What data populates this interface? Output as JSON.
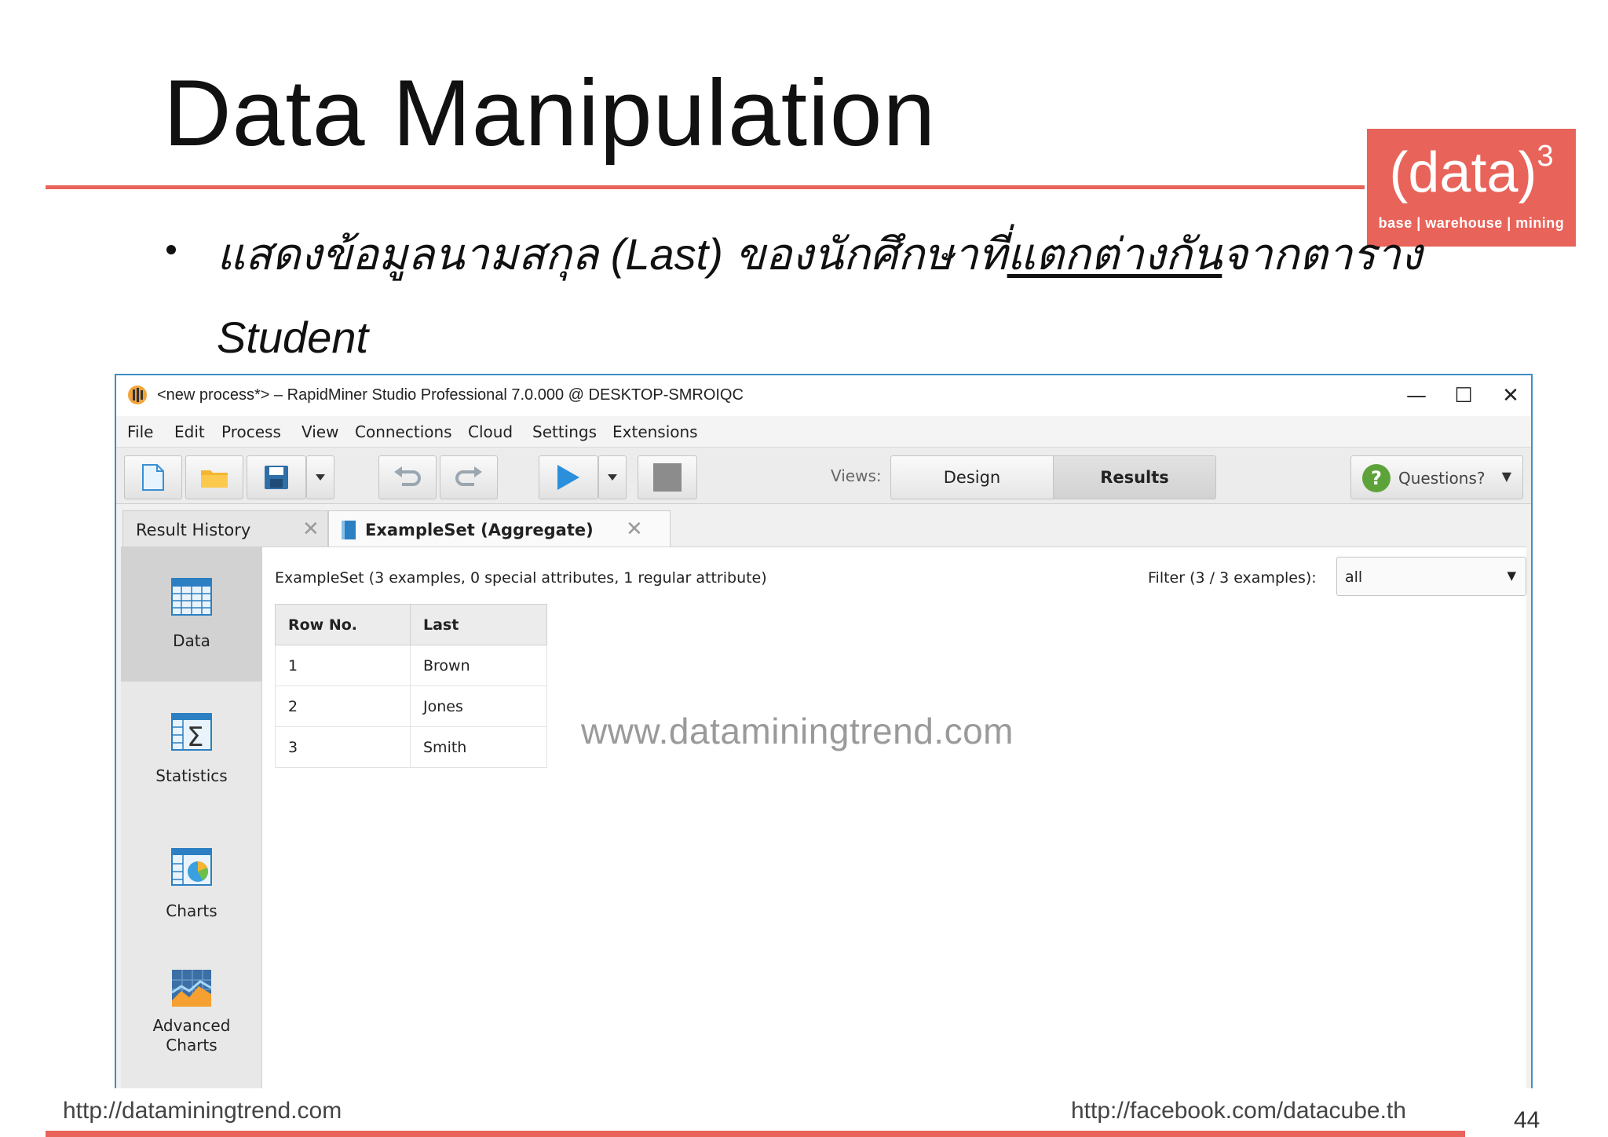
{
  "slide": {
    "title": "Data Manipulation",
    "bullet_part1": "แสดงข้อมูลนามสกุล (Last) ของนักศึกษาที่",
    "bullet_underlined": "แตกต่างกัน",
    "bullet_part2": "จากตาราง",
    "bullet_line2": "Student",
    "logo_main": "(data)",
    "logo_exponent": "3",
    "logo_sub": "base | warehouse | mining",
    "footer_left": "http://dataminingtrend.com",
    "footer_right": "http://facebook.com/datacube.th",
    "page_number": "44",
    "watermark": "www.dataminingtrend.com",
    "accent_color": "#e8635a"
  },
  "window": {
    "title": "<new process*> – RapidMiner Studio Professional 7.0.000 @ DESKTOP-SMROIQC",
    "minimize": "—",
    "maximize": "☐",
    "close": "✕",
    "border_color": "#3c8fc6"
  },
  "menu": [
    "File",
    "Edit",
    "Process",
    "View",
    "Connections",
    "Cloud",
    "Settings",
    "Extensions"
  ],
  "toolbar": {
    "views_label": "Views:",
    "design_label": "Design",
    "results_label": "Results",
    "questions_label": "Questions?",
    "questions_icon": "?",
    "dropdown_glyph": "▼"
  },
  "tabs": {
    "history_label": "Result History",
    "example_label": "ExampleSet (Aggregate)",
    "close_glyph": "✕"
  },
  "sidebar": {
    "items": [
      {
        "label": "Data",
        "icon": "table-icon",
        "active": true
      },
      {
        "label": "Statistics",
        "icon": "statistics-icon",
        "active": false
      },
      {
        "label": "Charts",
        "icon": "charts-icon",
        "active": false
      },
      {
        "label": "Advanced Charts",
        "icon": "advanced-charts-icon",
        "active": false
      }
    ]
  },
  "results": {
    "meta": "ExampleSet (3 examples, 0 special attributes, 1 regular attribute)",
    "filter_label": "Filter (3 / 3 examples):",
    "filter_value": "all",
    "columns": [
      "Row No.",
      "Last"
    ],
    "rows": [
      [
        "1",
        "Brown"
      ],
      [
        "2",
        "Jones"
      ],
      [
        "3",
        "Smith"
      ]
    ]
  }
}
